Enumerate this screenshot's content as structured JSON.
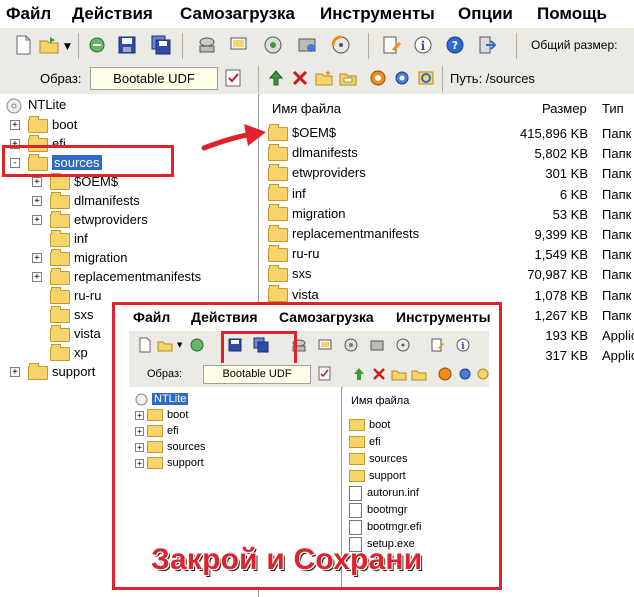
{
  "menu": [
    "Файл",
    "Действия",
    "Самозагрузка",
    "Инструменты",
    "Опции",
    "Помощь"
  ],
  "toolbar": {
    "size_label": "Общий размер:"
  },
  "image_bar": {
    "label": "Образ:",
    "value": "Bootable UDF",
    "path_label": "Путь: /sources"
  },
  "tree": {
    "root": "NTLite",
    "items": [
      {
        "label": "boot",
        "expander": "+"
      },
      {
        "label": "efi",
        "expander": "+"
      },
      {
        "label": "sources",
        "expander": "-"
      },
      {
        "label": "$OEM$",
        "expander": "+"
      },
      {
        "label": "dlmanifests",
        "expander": "+"
      },
      {
        "label": "etwproviders",
        "expander": "+"
      },
      {
        "label": "inf",
        "expander": ""
      },
      {
        "label": "migration",
        "expander": "+"
      },
      {
        "label": "replacementmanifests",
        "expander": "+"
      },
      {
        "label": "ru-ru",
        "expander": ""
      },
      {
        "label": "sxs",
        "expander": ""
      },
      {
        "label": "vista",
        "expander": ""
      },
      {
        "label": "xp",
        "expander": ""
      },
      {
        "label": "support",
        "expander": "+"
      }
    ]
  },
  "filelist": {
    "headers": {
      "name": "Имя файла",
      "size": "Размер",
      "type": "Тип"
    },
    "rows": [
      {
        "name": "$OEM$",
        "size": "415,896 KB",
        "type": "Папк"
      },
      {
        "name": "dlmanifests",
        "size": "5,802 KB",
        "type": "Папк"
      },
      {
        "name": "etwproviders",
        "size": "301 KB",
        "type": "Папк"
      },
      {
        "name": "inf",
        "size": "6 KB",
        "type": "Папк"
      },
      {
        "name": "migration",
        "size": "53 KB",
        "type": "Папк"
      },
      {
        "name": "replacementmanifests",
        "size": "9,399 KB",
        "type": "Папк"
      },
      {
        "name": "ru-ru",
        "size": "1,549 KB",
        "type": "Папк"
      },
      {
        "name": "sxs",
        "size": "70,987 KB",
        "type": "Папк"
      },
      {
        "name": "vista",
        "size": "1,078 KB",
        "type": "Папк"
      },
      {
        "name": "",
        "size": "1,267 KB",
        "type": "Папк"
      },
      {
        "name": "",
        "size": "193 KB",
        "type": "Applic"
      },
      {
        "name": "",
        "size": "317 KB",
        "type": "Applic"
      }
    ]
  },
  "inset": {
    "menu": [
      "Файл",
      "Действия",
      "Самозагрузка",
      "Инструменты"
    ],
    "image_label": "Образ:",
    "image_value": "Bootable UDF",
    "tree_root": "NTLite",
    "tree_items": [
      "boot",
      "efi",
      "sources",
      "support"
    ],
    "list_header": "Имя файла",
    "list_items": [
      {
        "name": "boot",
        "kind": "folder"
      },
      {
        "name": "efi",
        "kind": "folder"
      },
      {
        "name": "sources",
        "kind": "folder"
      },
      {
        "name": "support",
        "kind": "folder"
      },
      {
        "name": "autorun.inf",
        "kind": "file"
      },
      {
        "name": "bootmgr",
        "kind": "file"
      },
      {
        "name": "bootmgr.efi",
        "kind": "file"
      },
      {
        "name": "setup.exe",
        "kind": "file"
      }
    ],
    "caption": "Закрой и Сохрани"
  },
  "colors": {
    "highlight_red": "#e0222a",
    "folder": "#f6d46b",
    "toolbar_bg": "#eceae4",
    "selection": "#3169c6"
  }
}
